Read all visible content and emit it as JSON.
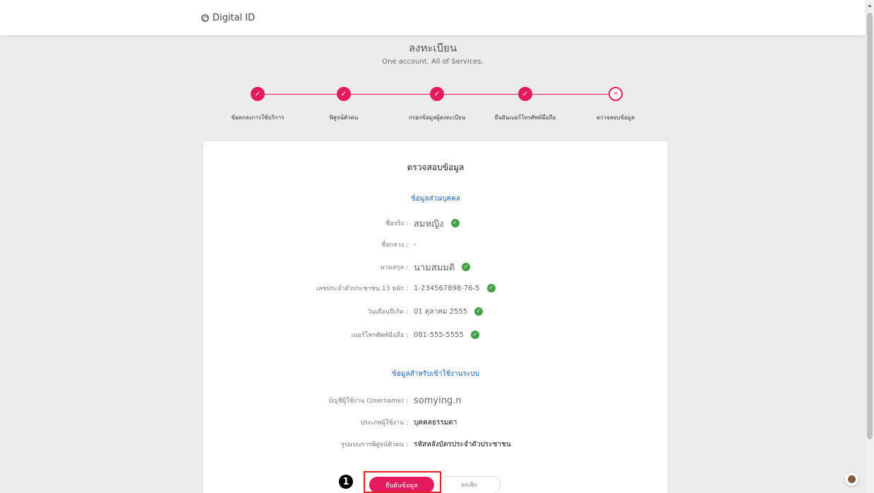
{
  "header": {
    "brand": "Digital ID",
    "title": "ลงทะเบียน",
    "subtitle": "One account. All of Services."
  },
  "stepper": {
    "steps": [
      {
        "label": "ข้อตกลงการใช้บริการ",
        "status": "done",
        "icon": "✓"
      },
      {
        "label": "พิสูจน์ตัวตน",
        "status": "done",
        "icon": "✓"
      },
      {
        "label": "กรอกข้อมูลผู้ลงทะเบียน",
        "status": "done",
        "icon": "✓"
      },
      {
        "label": "ยืนยันเบอร์โทรศัพท์มือถือ",
        "status": "done",
        "icon": "✓"
      },
      {
        "label": "ตรวจสอบข้อมูล",
        "status": "current",
        "icon": "≈"
      }
    ]
  },
  "card": {
    "title": "ตรวจสอบข้อมูล",
    "personal_section": "ข้อมูลส่วนบุคคล",
    "personal": [
      {
        "label": "ชื่อจริง :",
        "value": "สมหญิง",
        "verified": true
      },
      {
        "label": "ชื่อกลาง :",
        "value": "-",
        "verified": false
      },
      {
        "label": "นามสกุล :",
        "value": "นามสมมติ",
        "verified": true
      },
      {
        "label": "เลขประจำตัวประชาชน 13 หลัก :",
        "value": "1-234567898-76-5",
        "verified": true
      },
      {
        "label": "วันเดือนปีเกิด :",
        "value": "01 ตุลาคม 2555",
        "verified": true
      },
      {
        "label": "เบอร์โทรศัพท์มือถือ :",
        "value": "081-555-5555",
        "verified": true
      }
    ],
    "login_section": "ข้อมูลสำหรับเข้าใช้งานระบบ",
    "login": [
      {
        "label": "บัญชีผู้ใช้งาน (Username) :",
        "value": "somying.n"
      },
      {
        "label": "ประเภทผู้ใช้งาน :",
        "value": "บุคคลธรรมดา"
      },
      {
        "label": "รูปแบบการพิสูจน์ตัวตน :",
        "value": "รหัสหลังบัตรประจำตัวประชาชน"
      }
    ]
  },
  "actions": {
    "confirm_label": "ยืนยันข้อมูล",
    "cancel_label": "ยกเลิก",
    "annotation_number": "1"
  },
  "colors": {
    "accent": "#e5195e",
    "verified": "#43a047",
    "section_title": "#1a66b8",
    "highlight": "#e0202a"
  },
  "icons": {
    "brand": "fingerprint-icon",
    "step_done": "check-icon",
    "step_current": "review-icon",
    "verified": "verified-check-icon",
    "avatar": "cookie-icon"
  }
}
